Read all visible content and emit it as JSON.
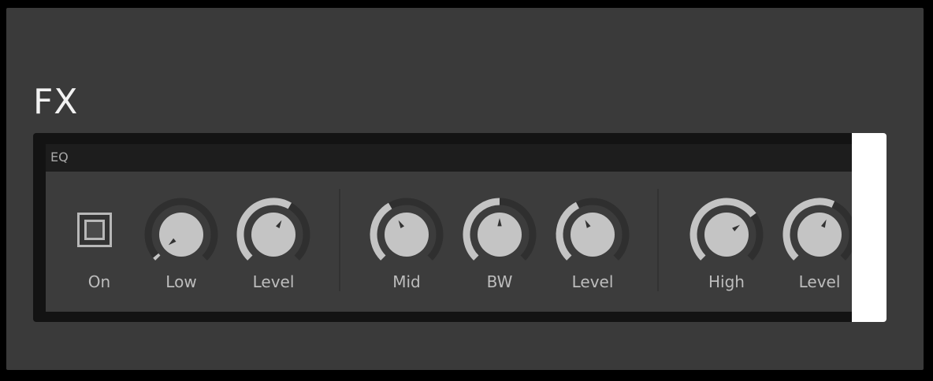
{
  "section_title": "FX",
  "eq": {
    "title": "EQ",
    "on_label": "On",
    "knobs": [
      {
        "label": "Low",
        "value": 0.02
      },
      {
        "label": "Level",
        "value": 0.61
      },
      {
        "label": "Mid",
        "value": 0.39
      },
      {
        "label": "BW",
        "value": 0.5
      },
      {
        "label": "Level",
        "value": 0.4
      },
      {
        "label": "High",
        "value": 0.7
      },
      {
        "label": "Level",
        "value": 0.59
      }
    ]
  },
  "colors": {
    "background": "#000000",
    "panel": "#3a3a3a",
    "knob_body": "#c4c4c4",
    "knob_track": "#2f2f2f",
    "knob_arc": "#c4c4c4",
    "text": "#bdbdbd"
  }
}
